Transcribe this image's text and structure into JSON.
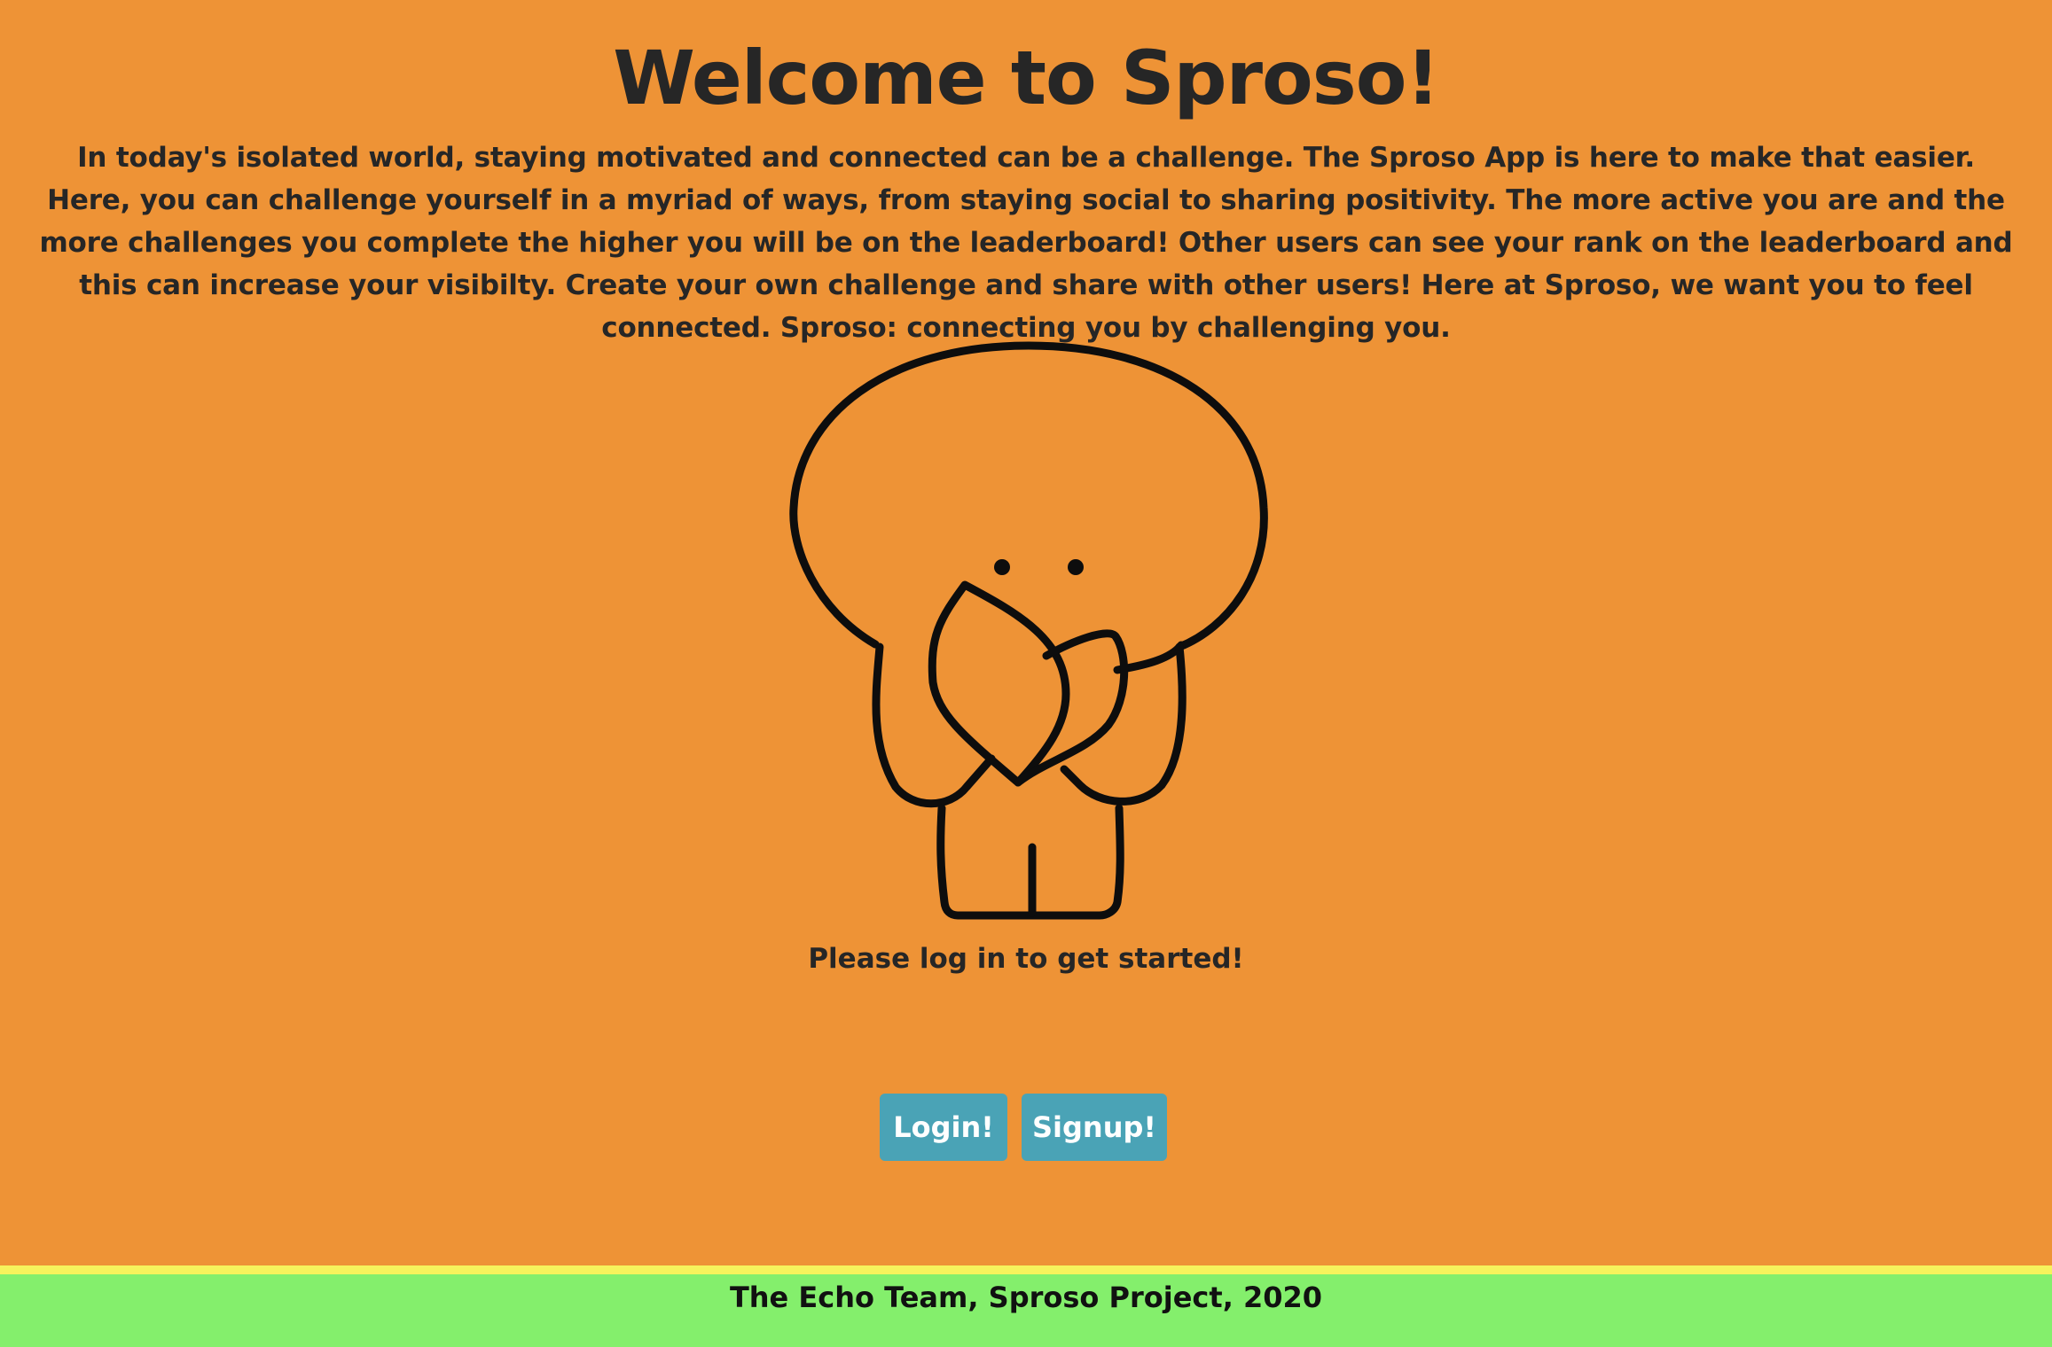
{
  "page": {
    "title": "Welcome to Sproso!",
    "intro": "In today's isolated world, staying motivated and connected can be a challenge. The Sproso App is here to make that easier. Here, you can challenge yourself in a myriad of ways, from staying social to sharing positivity. The more active you are and the more challenges you complete the higher you will be on the leaderboard! Other users can see your rank on the leaderboard and this can increase your visibilty. Create your own challenge and share with other users! Here at Sproso, we want you to feel connected. Sproso: connecting you by challenging you.",
    "prompt": "Please log in to get started!"
  },
  "actions": {
    "login_label": "Login!",
    "signup_label": "Signup!"
  },
  "footer": {
    "text": "The Echo Team, Sproso Project, 2020"
  },
  "mascot": {
    "icon": "sprout-mascot-icon"
  },
  "colors": {
    "background": "#ee9336",
    "button": "#4aa3b6",
    "button_text": "#ffffff",
    "footer": "#84ef6c",
    "footer_stripe": "#f6f35c",
    "text": "#262626"
  }
}
